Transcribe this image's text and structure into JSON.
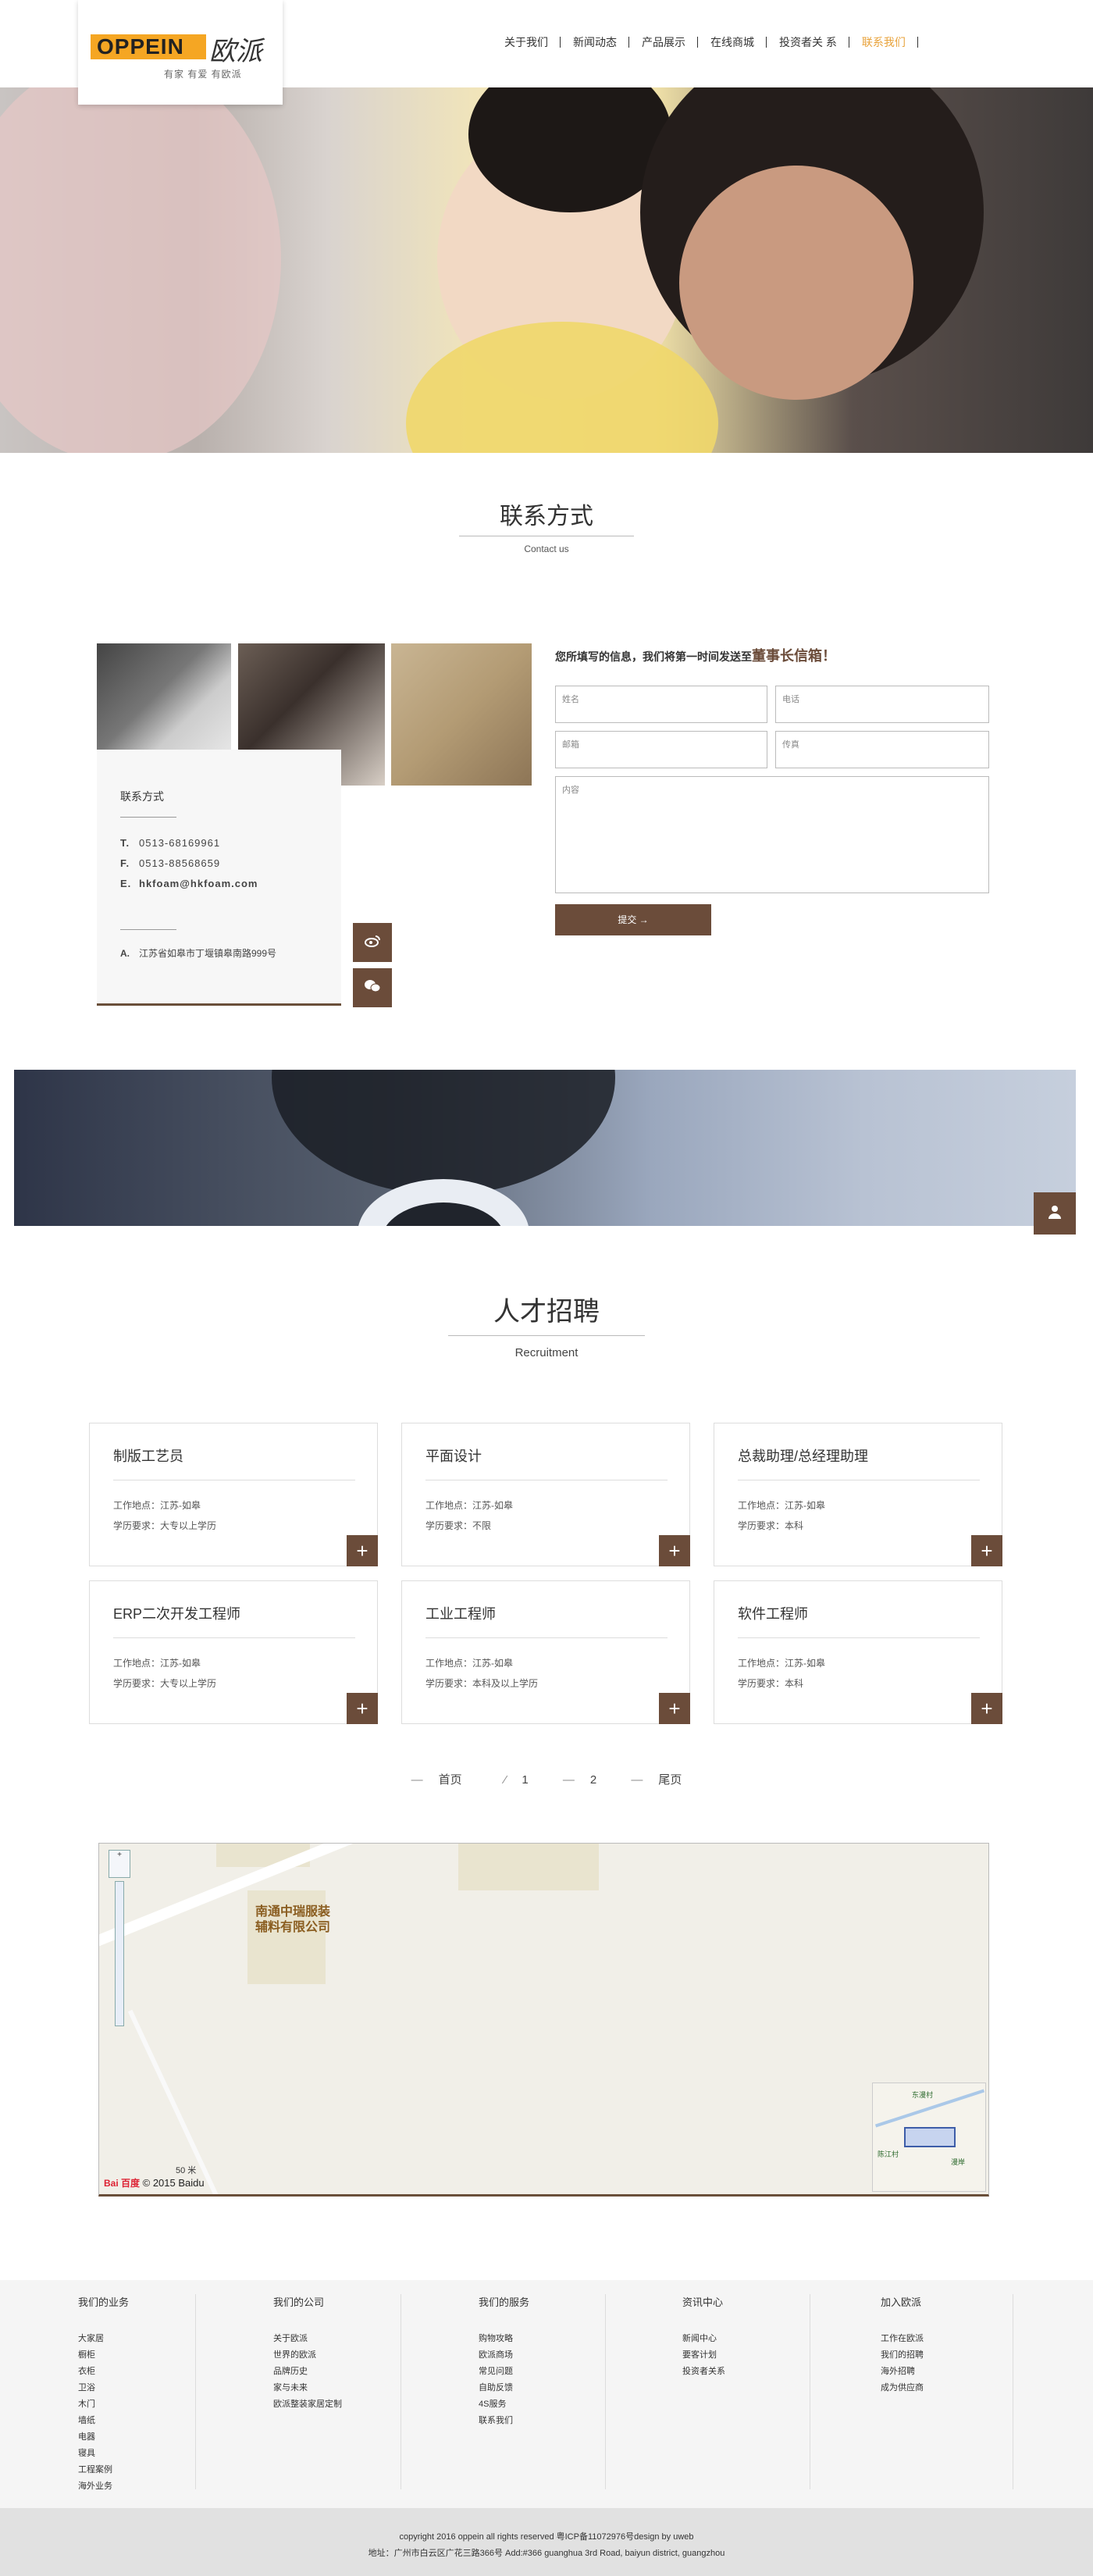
{
  "brand": {
    "logo_en": "OPPEIN",
    "logo_cn": "欧派",
    "slogan": "有家 有爱 有欧派"
  },
  "nav": {
    "items": [
      {
        "label": "关于我们"
      },
      {
        "label": "新闻动态"
      },
      {
        "label": "产品展示"
      },
      {
        "label": "在线商城"
      },
      {
        "label": "投资者关 系"
      },
      {
        "label": "联系我们"
      }
    ],
    "active_index": 5,
    "active_color": "#e8a23a"
  },
  "contact": {
    "title": "联系方式",
    "subtitle": "Contact us",
    "card_title": "联系方式",
    "tel_label": "T.",
    "tel": "0513-68169961",
    "fax_label": "F.",
    "fax": "0513-88568659",
    "email_label": "E.",
    "email": "hkfoam@hkfoam.com",
    "addr_label": "A.",
    "address": "江苏省如皋市丁堰镇皋南路999号",
    "weibo_icon": "weibo-icon",
    "wechat_icon": "wechat-icon"
  },
  "form": {
    "note_prefix": "您所填写的信息，我们将第一时间发送至",
    "note_highlight": "董事长信箱！",
    "name_placeholder": "姓名",
    "phone_placeholder": "电话",
    "email_placeholder": "邮箱",
    "fax_placeholder": "传真",
    "content_placeholder": "内容",
    "submit_label": "提交 →"
  },
  "recruit": {
    "title": "人才招聘",
    "subtitle": "Recruitment",
    "jobs": [
      {
        "title": "制版工艺员",
        "location": "工作地点：江苏-如皋",
        "education": "学历要求：大专以上学历"
      },
      {
        "title": "平面设计",
        "location": "工作地点：江苏-如皋",
        "education": "学历要求：不限"
      },
      {
        "title": "总裁助理/总经理助理",
        "location": "工作地点：江苏-如皋",
        "education": "学历要求：本科"
      },
      {
        "title": "ERP二次开发工程师",
        "location": "工作地点：江苏-如皋",
        "education": "学历要求：大专以上学历"
      },
      {
        "title": "工业工程师",
        "location": "工作地点：江苏-如皋",
        "education": "学历要求：本科及以上学历"
      },
      {
        "title": "软件工程师",
        "location": "工作地点：江苏-如皋",
        "education": "学历要求：本科"
      }
    ],
    "plus": "+"
  },
  "pager": {
    "first": "首页",
    "p1": "1",
    "p2": "2",
    "last": "尾页"
  },
  "map": {
    "label_line1": "南通中瑞服装",
    "label_line2": "辅料有限公司",
    "scale": "50 米",
    "copyright": "© 2015 Baidu",
    "logo": "Bai 百度",
    "mini_label1": "东漫村",
    "mini_label2": "陈江村",
    "mini_label3": "漫岸"
  },
  "footer": {
    "cols": [
      {
        "title": "我们的业务",
        "items": [
          "大家居",
          "橱柜",
          "衣柜",
          "卫浴",
          "木门",
          "墙纸",
          "电器",
          "寝具",
          "工程案例",
          "海外业务"
        ]
      },
      {
        "title": "我们的公司",
        "items": [
          "关于欧派",
          "世界的欧派",
          "品牌历史",
          "家与未来",
          "欧派整装家居定制"
        ]
      },
      {
        "title": "我们的服务",
        "items": [
          "购物攻略",
          "欧派商场",
          "常见问题",
          "自助反馈",
          "4S服务",
          "联系我们"
        ]
      },
      {
        "title": "资讯中心",
        "items": [
          "新闻中心",
          "要客计划",
          "投资者关系"
        ]
      },
      {
        "title": "加入欧派",
        "items": [
          "工作在欧派",
          "我们的招聘",
          "海外招聘",
          "成为供应商"
        ]
      }
    ],
    "copyright_line1": "copyright 2016 oppein all rights reserved 粤ICP备11072976号design by uweb",
    "copyright_line2": "地址：广州市白云区广花三路366号 Add:#366 guanghua 3rd Road, baiyun district, guangzhou"
  },
  "colors": {
    "brown": "#6b4c3a",
    "orange": "#f5a623"
  }
}
